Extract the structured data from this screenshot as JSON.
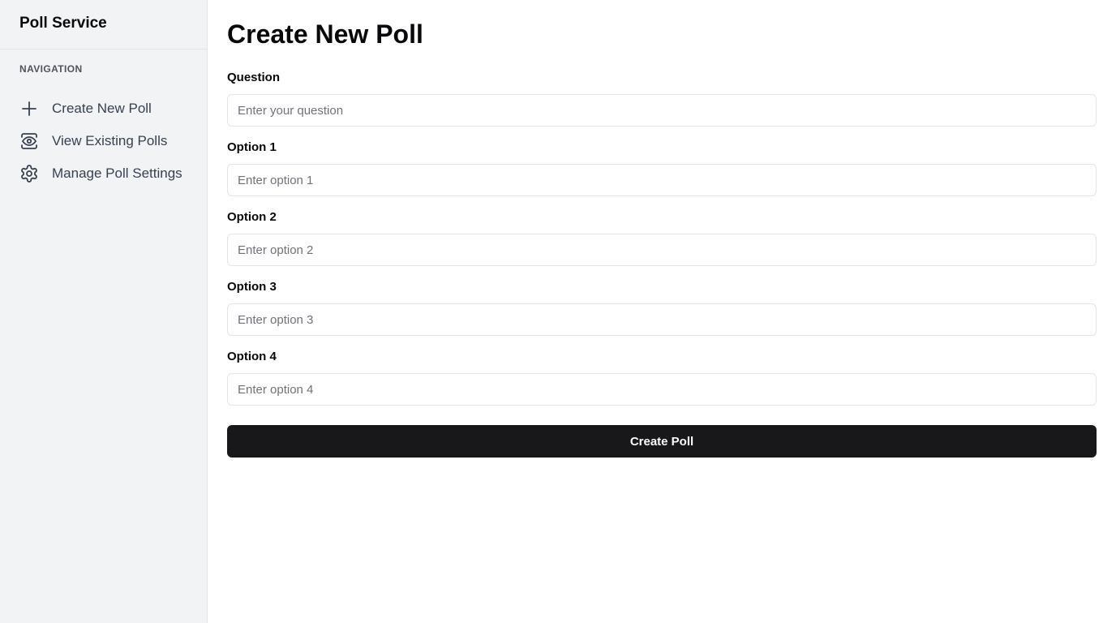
{
  "sidebar": {
    "app_title": "Poll Service",
    "nav_heading": "NAVIGATION",
    "items": [
      {
        "label": "Create New Poll",
        "icon": "plus-icon"
      },
      {
        "label": "View Existing Polls",
        "icon": "eye-icon"
      },
      {
        "label": "Manage Poll Settings",
        "icon": "gear-icon"
      }
    ]
  },
  "main": {
    "title": "Create New Poll",
    "question": {
      "label": "Question",
      "placeholder": "Enter your question",
      "value": ""
    },
    "options": [
      {
        "label": "Option 1",
        "placeholder": "Enter option 1",
        "value": ""
      },
      {
        "label": "Option 2",
        "placeholder": "Enter option 2",
        "value": ""
      },
      {
        "label": "Option 3",
        "placeholder": "Enter option 3",
        "value": ""
      },
      {
        "label": "Option 4",
        "placeholder": "Enter option 4",
        "value": ""
      }
    ],
    "submit_label": "Create Poll"
  },
  "colors": {
    "sidebar_bg": "#f1f3f5",
    "primary_button": "#18181b",
    "border": "#e4e4e7"
  }
}
